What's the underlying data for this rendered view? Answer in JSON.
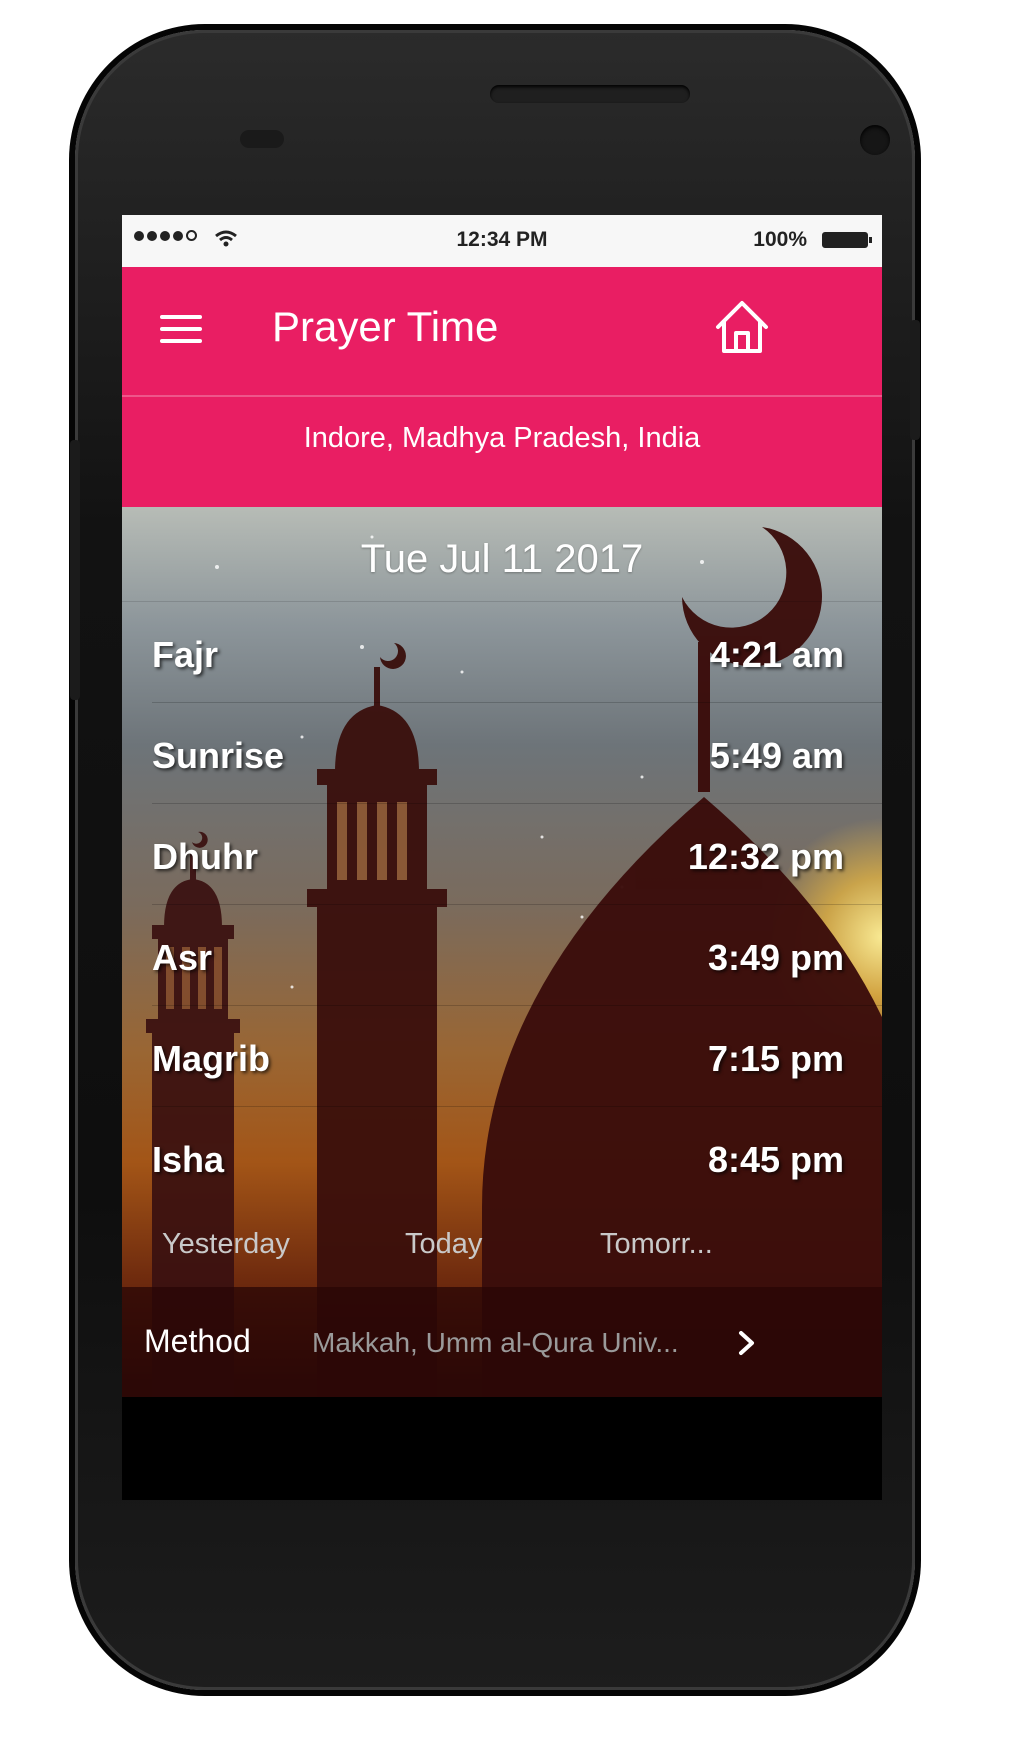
{
  "status_bar": {
    "time": "12:34 PM",
    "battery": "100%",
    "icons": [
      "signal-dots-icon",
      "wifi-icon",
      "battery-icon"
    ]
  },
  "app_bar": {
    "title": "Prayer Time",
    "location": "Indore, Madhya Pradesh, India",
    "accent_color": "#e91e63",
    "icons": [
      "menu-icon",
      "home-icon"
    ]
  },
  "date": "Tue Jul 11 2017",
  "prayers": [
    {
      "name": "Fajr",
      "time": "4:21 am"
    },
    {
      "name": "Sunrise",
      "time": "5:49 am"
    },
    {
      "name": "Dhuhr",
      "time": "12:32 pm"
    },
    {
      "name": "Asr",
      "time": "3:49 pm"
    },
    {
      "name": "Magrib",
      "time": "7:15 pm"
    },
    {
      "name": "Isha",
      "time": "8:45 pm"
    }
  ],
  "day_tabs": {
    "yesterday": "Yesterday",
    "today": "Today",
    "tomorrow": "Tomorr..."
  },
  "method": {
    "label": "Method",
    "value": "Makkah, Umm al-Qura Univ...",
    "icon": "chevron-right-icon"
  }
}
